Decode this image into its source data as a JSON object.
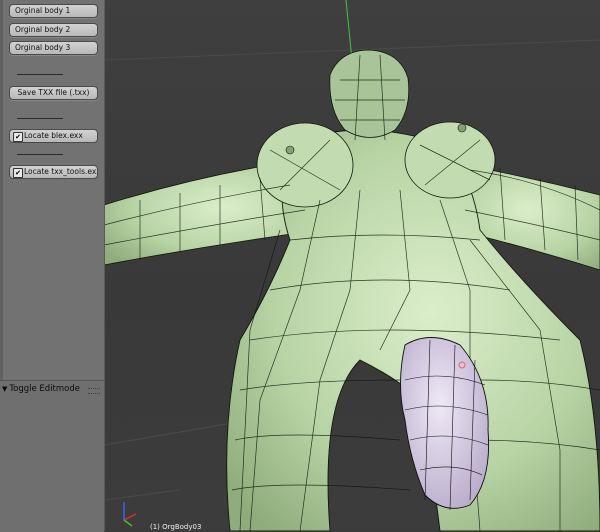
{
  "panel": {
    "buttons": [
      {
        "label": "Orginal body 1"
      },
      {
        "label": "Orginal body 2"
      },
      {
        "label": "Orginal body 3"
      }
    ],
    "save_button": {
      "label": "Save TXX file (.txx)"
    },
    "checkboxes": [
      {
        "label": "Locate blex.exx",
        "checked": true,
        "mark": "✔"
      },
      {
        "label": "Locate txx_tools.exx",
        "checked": true,
        "mark": "✔"
      }
    ]
  },
  "operator_panel": {
    "title": "Toggle Editmode"
  },
  "viewport": {
    "object_label": "(1) OrgBody03",
    "mesh_color": "#c8dfb6",
    "selected_color": "#cfc5df",
    "wire_color": "#0e1a0a",
    "axis_colors": {
      "x": "#d03030",
      "y": "#3ac93a",
      "z": "#3a64e8"
    }
  }
}
